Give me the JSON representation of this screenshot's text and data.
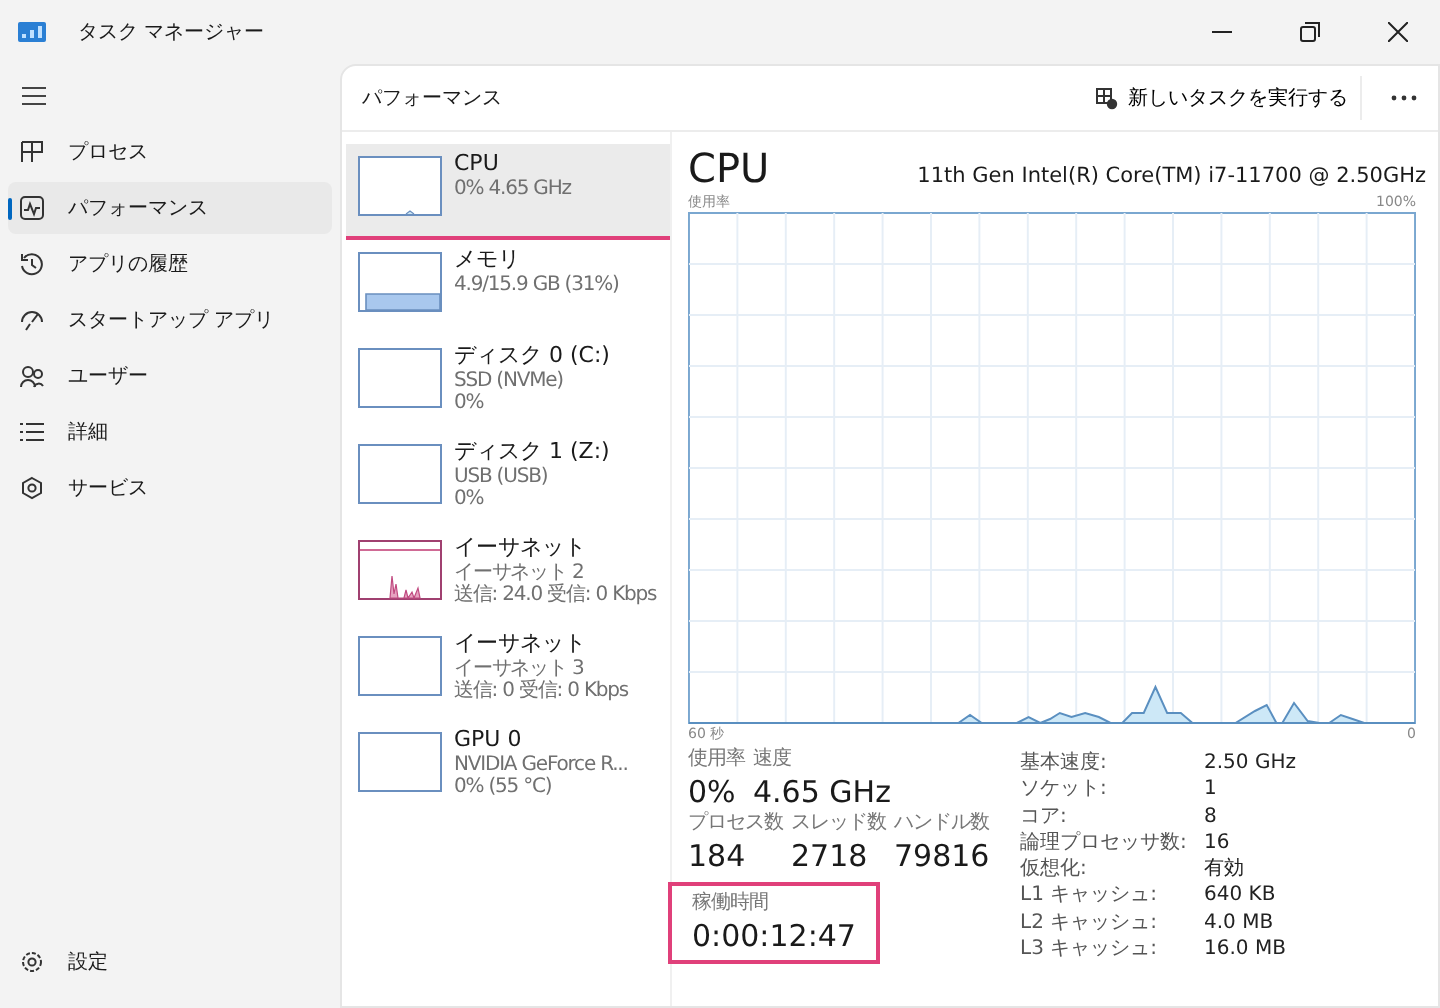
{
  "window": {
    "title": "タスク マネージャー"
  },
  "sidebar": {
    "items": [
      {
        "label": "プロセス",
        "selected": false
      },
      {
        "label": "パフォーマンス",
        "selected": true
      },
      {
        "label": "アプリの履歴",
        "selected": false
      },
      {
        "label": "スタートアップ アプリ",
        "selected": false
      },
      {
        "label": "ユーザー",
        "selected": false
      },
      {
        "label": "詳細",
        "selected": false
      },
      {
        "label": "サービス",
        "selected": false
      }
    ],
    "settings": "設定"
  },
  "header": {
    "title": "パフォーマンス",
    "run_task": "新しいタスクを実行する"
  },
  "devices": [
    {
      "name": "CPU",
      "lines": [
        "0% 4.65 GHz"
      ],
      "kind": "cpu",
      "selected": true,
      "highlighted": true
    },
    {
      "name": "メモリ",
      "lines": [
        "4.9/15.9 GB (31%)"
      ],
      "kind": "memory",
      "selected": false,
      "highlighted": false
    },
    {
      "name": "ディスク 0 (C:)",
      "lines": [
        "SSD (NVMe)",
        "0%"
      ],
      "kind": "empty",
      "selected": false,
      "highlighted": false
    },
    {
      "name": "ディスク 1 (Z:)",
      "lines": [
        "USB (USB)",
        "0%"
      ],
      "kind": "empty",
      "selected": false,
      "highlighted": false
    },
    {
      "name": "イーサネット",
      "lines": [
        "イーサネット 2",
        "送信: 24.0 受信: 0 Kbps"
      ],
      "kind": "network",
      "selected": false,
      "highlighted": false
    },
    {
      "name": "イーサネット",
      "lines": [
        "イーサネット 3",
        "送信: 0 受信: 0 Kbps"
      ],
      "kind": "empty",
      "selected": false,
      "highlighted": false
    },
    {
      "name": "GPU 0",
      "lines": [
        "NVIDIA GeForce R...",
        "0% (55 °C)"
      ],
      "kind": "empty",
      "selected": false,
      "highlighted": false
    }
  ],
  "detail": {
    "title": "CPU",
    "model": "11th Gen Intel(R) Core(TM) i7-11700 @ 2.50GHz",
    "graph": {
      "y_label": "使用率",
      "y_max": "100%",
      "x_start": "60 秒",
      "x_end": "0"
    },
    "stats": [
      [
        {
          "label": "使用率",
          "value": "0%"
        },
        {
          "label": "速度",
          "value": "4.65 GHz"
        }
      ],
      [
        {
          "label": "プロセス数",
          "value": "184"
        },
        {
          "label": "スレッド数",
          "value": "2718"
        },
        {
          "label": "ハンドル数",
          "value": "79816"
        }
      ]
    ],
    "uptime": {
      "label": "稼働時間",
      "value": "0:00:12:47",
      "highlighted": true
    },
    "specs": [
      {
        "label": "基本速度:",
        "value": "2.50 GHz"
      },
      {
        "label": "ソケット:",
        "value": "1"
      },
      {
        "label": "コア:",
        "value": "8"
      },
      {
        "label": "論理プロセッサ数:",
        "value": "16"
      },
      {
        "label": "仮想化:",
        "value": "有効"
      },
      {
        "label": "L1 キャッシュ:",
        "value": "640 KB"
      },
      {
        "label": "L2 キャッシュ:",
        "value": "4.0 MB"
      },
      {
        "label": "L3 キャッシュ:",
        "value": "16.0 MB"
      }
    ]
  }
}
